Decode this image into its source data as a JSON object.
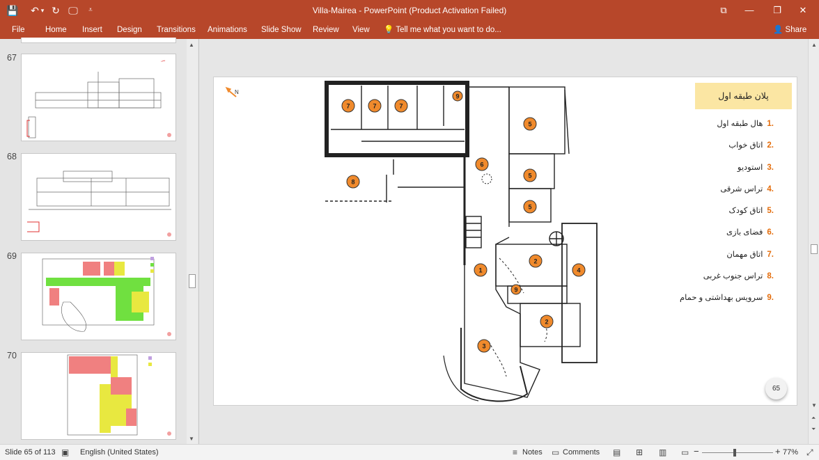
{
  "window": {
    "title": "Villa-Mairea - PowerPoint (Product Activation Failed)",
    "controls": {
      "restore_ribbon": "⧉",
      "minimize": "—",
      "maximize": "❐",
      "close": "✕"
    }
  },
  "quick_access": {
    "save": "💾",
    "undo": "↶",
    "undo_more": "▾",
    "redo": "↻",
    "start": "🖵",
    "customize": "⩡"
  },
  "ribbon": {
    "tabs": [
      "File",
      "Home",
      "Insert",
      "Design",
      "Transitions",
      "Animations",
      "Slide Show",
      "Review",
      "View"
    ],
    "tell_me": "Tell me what you want to do...",
    "share": "Share"
  },
  "thumbnails": [
    {
      "number": "67"
    },
    {
      "number": "68"
    },
    {
      "number": "69"
    },
    {
      "number": "70"
    }
  ],
  "slide": {
    "title": "پلان طبقه اول",
    "page_number": "65",
    "legend": [
      {
        "num": ".1",
        "label": "هال طبقه اول"
      },
      {
        "num": ".2",
        "label": "اتاق خواب"
      },
      {
        "num": ".3",
        "label": "استودیو"
      },
      {
        "num": ".4",
        "label": "تراس شرقی"
      },
      {
        "num": ".5",
        "label": "اتاق کودک"
      },
      {
        "num": ".6",
        "label": "فضای بازی"
      },
      {
        "num": ".7",
        "label": "اتاق مهمان"
      },
      {
        "num": ".8",
        "label": "تراس جنوب غربی"
      },
      {
        "num": ".9",
        "label": "سرویس بهداشتی و حمام"
      }
    ],
    "markers": [
      "7",
      "7",
      "7",
      "9",
      "5",
      "6",
      "8",
      "5",
      "5",
      "1",
      "2",
      "4",
      "9",
      "2",
      "3"
    ],
    "north": "N",
    "accent_color": "#f08a2c"
  },
  "status": {
    "slide_info": "Slide 65 of 113",
    "language": "English (United States)",
    "notes": "Notes",
    "comments": "Comments",
    "zoom": "77%",
    "zoom_minus": "−",
    "zoom_plus": "+"
  }
}
